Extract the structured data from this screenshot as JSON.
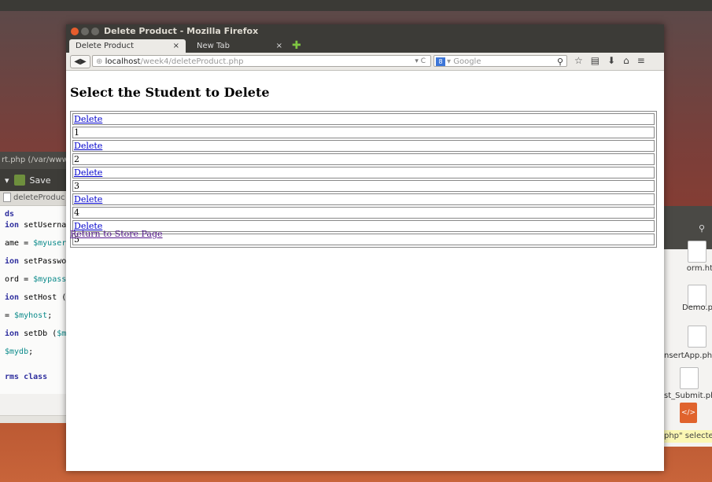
{
  "editor": {
    "title": "rt.php (/var/www",
    "save_label": "Save",
    "tab_label": "deleteProduc",
    "code_lines": [
      {
        "kw": "ds",
        "rest": ""
      },
      {
        "kw": "ion",
        "rest": " setUsernam"
      },
      {
        "kw": "",
        "rest": "ame = ",
        "var": "$myuser"
      },
      {
        "kw": "ion",
        "rest": " setPasswo"
      },
      {
        "kw": "",
        "rest": "ord = ",
        "var": "$mypass"
      },
      {
        "kw": "ion",
        "rest": " setHost ("
      },
      {
        "kw": "",
        "rest": "= ",
        "var": "$myhost",
        "tail": ";"
      },
      {
        "kw": "ion",
        "rest": " setDb (",
        "var": "$m"
      },
      {
        "kw": "",
        "rest": "",
        "var": "$mydb",
        "tail": ";"
      },
      {
        "kw": "rms class",
        "rest": ""
      }
    ]
  },
  "files": {
    "items": [
      "orm.ht",
      "Demo.p",
      "nsertApp.php",
      "st_Submit.ph"
    ],
    "selected_status": "php\" selected"
  },
  "browser": {
    "window_title": "Delete Product - Mozilla Firefox",
    "tabs": [
      {
        "label": "Delete Product",
        "close": "×"
      },
      {
        "label": "New Tab",
        "close": "×"
      }
    ],
    "new_tab": "✚",
    "url_host": "localhost",
    "url_path": "/week4/deleteProduct.php",
    "url_controls": "▾ C",
    "search_placeholder": "Google",
    "search_engine": "8"
  },
  "page": {
    "heading": "Select the Student to Delete",
    "rows": [
      {
        "link": "Delete",
        "id": "1"
      },
      {
        "link": "Delete",
        "id": "2"
      },
      {
        "link": "Delete",
        "id": "3"
      },
      {
        "link": "Delete",
        "id": "4"
      },
      {
        "link": "Delete",
        "id": "5"
      }
    ],
    "return_link": "Return to Store Page"
  }
}
